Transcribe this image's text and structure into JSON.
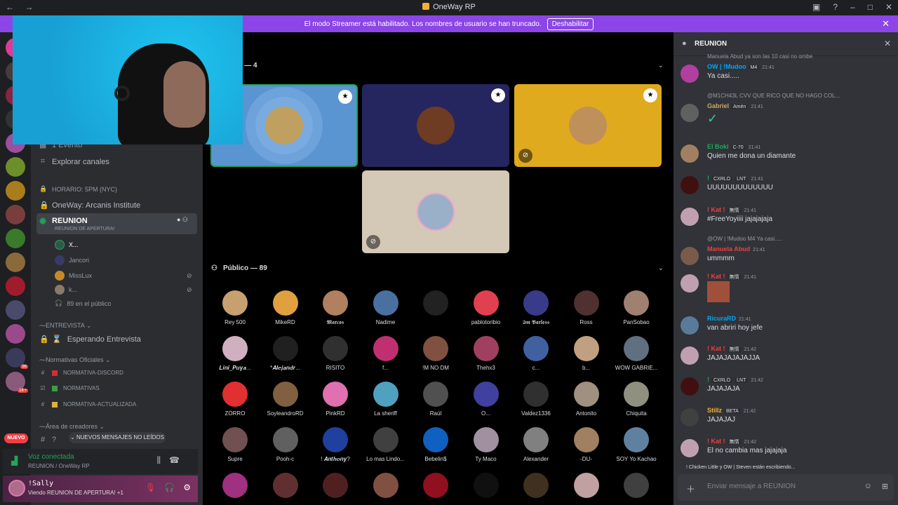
{
  "titlebar": {
    "app_title": "OneWay RP",
    "nav": "← →"
  },
  "banner": {
    "text": "El modo Streamer está habilitado. Los nombres de usuario se han truncado.",
    "button": "Deshabilitar"
  },
  "channels": {
    "event": "1 Evento",
    "explore": "Explorar canales",
    "horario": "horario: 5pm (nyc)",
    "institute": "OneWay: Arcanis Institute",
    "reunion": "REUNION",
    "reunion_sub": "REUNION DE APERTURA!",
    "voice_users": [
      {
        "name": "X..."
      },
      {
        "name": "Jancori"
      },
      {
        "name": "MissLux"
      },
      {
        "name": "k..."
      }
    ],
    "audience": "89 en el público",
    "cat_entrevista": "ENTREVISTA",
    "esperando": "Esperando Entrevista",
    "cat_normativas": "Normativas Oficiales",
    "norm1": "normativa-discord",
    "norm2": "normativas",
    "norm3": "normativa-actualizada",
    "cat_creadores": "Área de creadores",
    "new_messages": "NUEVOS MENSAJES NO LEÍDOS",
    "nuevo": "NUEVO",
    "badge_96": "96",
    "badge_1k": "1K+"
  },
  "voice": {
    "status": "Voz conectada",
    "channel": "REUNION / OneWay RP"
  },
  "user": {
    "name": "!Sally",
    "status": "Viendo REUNION DE APERTURA! +1"
  },
  "stage": {
    "speakers_header": "Oradores — 4",
    "public_header": "Público — 89",
    "audience": [
      "Rey 500",
      "MikeRD",
      "𝕸𝖆𝖗𝖈𝖔𝖘",
      "Nadime",
      "",
      "pablotoribio",
      "𝕴𝖒 𝕭𝖆𝖗𝖑𝖊𝖘𝖘",
      "Ross",
      "PanSobao",
      "𝑳𝒊𝒏𝒊_𝑷𝒖𝒚𝒂...",
      "*𝑨𝒍𝒆𝒋𝒂𝒏𝒅𝒓...",
      "RISITO",
      "f...",
      "!M NO DM",
      "Thehx3",
      "c...",
      "b...",
      "WOW GABRIE...",
      "ZORRO",
      "SoyleandroRD",
      "PinkRD",
      "La sheriff",
      "Raúl",
      "O...",
      "Valdez1336",
      "Antonito",
      "Chiquita",
      "Supre",
      "Pooh-c",
      "! 𝑨𝒏𝒕𝒉𝒐𝒏𝒚?",
      "Lo mas Lindo...",
      "Bebelin$",
      "Ty Maco",
      "Alexander",
      "-DU-",
      "SOY Yo Kachao"
    ]
  },
  "chat": {
    "title": "REUNION",
    "messages": [
      {
        "reply": "Manuela Abud ya son las 10 casi no ombe",
        "author": "OW | !Mudoo",
        "tag": "M4",
        "time": "21:41",
        "text": "Ya casi....."
      },
      {
        "reply": "@M1CH43L CVV QUE RICO QUE NO HAGO COL...",
        "author": "Gabriel",
        "tag": "Amén",
        "time": "21:41",
        "text": "✓"
      },
      {
        "author": "El Boki",
        "tag": "C-70",
        "time": "21:41",
        "text": "Quien me dona un diamante"
      },
      {
        "author": "!",
        "tag": "LNT",
        "time": "21:41",
        "text": "UUUUUUUUUUUUU",
        "pre": "CXRLO"
      },
      {
        "author": "! Kat !",
        "tag": "無情",
        "time": "21:41",
        "text": "#FreeYoyiiii jajajajaja"
      },
      {
        "reply": "@OW | !Mudoo M4 Ya casi.....",
        "author": "Manuela Abud",
        "time": "21:41",
        "text": "ummmm"
      },
      {
        "author": "! Kat !",
        "tag": "無情",
        "time": "21:41",
        "text": ""
      },
      {
        "author": "RicuraRD",
        "time": "21:41",
        "text": "van abriri hoy jefe"
      },
      {
        "author": "! Kat !",
        "tag": "無情",
        "time": "21:42",
        "text": "JAJAJAJAJAJJA"
      },
      {
        "author": "!",
        "tag": "LNT",
        "time": "21:42",
        "text": "JAJAJAJA",
        "pre": "CXRLO"
      },
      {
        "author": "Stillz",
        "tag": "BETA",
        "time": "21:42",
        "text": "JAJAJAJ"
      },
      {
        "author": "! Kat !",
        "tag": "無情",
        "time": "21:42",
        "text": "El no cambia mas jajajaja"
      }
    ],
    "typing": "! Chicken Little y OW | Steven están escribiendo...",
    "placeholder": "Enviar mensaje a  REUNION"
  },
  "colors": {
    "accent": "#8c45e6",
    "green": "#23a55a",
    "tile_blue": "#5a94d1",
    "tile_navy": "#25265f",
    "tile_yellow": "#e0aa1f",
    "tile_beige": "#d4c8b6"
  }
}
